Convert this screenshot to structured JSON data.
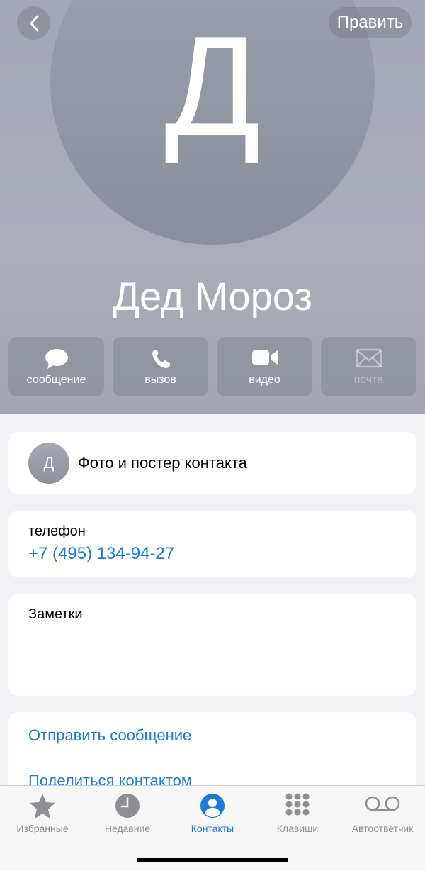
{
  "header": {
    "avatar_letter": "Д",
    "edit_label": "Править",
    "contact_name": "Дед Мороз"
  },
  "actions": [
    {
      "label": "сообщение",
      "icon": "message-bubble-icon",
      "enabled": true
    },
    {
      "label": "вызов",
      "icon": "phone-icon",
      "enabled": true
    },
    {
      "label": "видео",
      "icon": "video-camera-icon",
      "enabled": true
    },
    {
      "label": "почта",
      "icon": "envelope-icon",
      "enabled": false
    }
  ],
  "photo_card": {
    "avatar_letter": "Д",
    "label": "Фото и постер контакта"
  },
  "phone_card": {
    "label": "телефон",
    "value": "+7 (495) 134-94-27"
  },
  "notes_card": {
    "label": "Заметки"
  },
  "links": {
    "send_message": "Отправить сообщение",
    "share_contact": "Поделиться контактом"
  },
  "tabbar": {
    "items": [
      {
        "label": "Избранные",
        "icon": "star-icon"
      },
      {
        "label": "Недавние",
        "icon": "clock-icon"
      },
      {
        "label": "Контакты",
        "icon": "person-circle-icon"
      },
      {
        "label": "Клавиши",
        "icon": "keypad-icon"
      },
      {
        "label": "Автоответчик",
        "icon": "voicemail-icon"
      }
    ],
    "active_index": 2
  },
  "colors": {
    "accent": "#1a7bd8",
    "header_bg": "#a4a8b4",
    "inactive_tab": "#8e8e93"
  }
}
